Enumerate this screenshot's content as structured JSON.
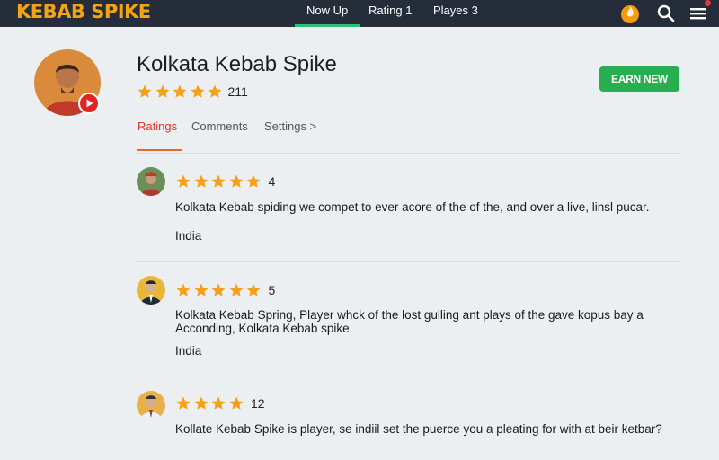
{
  "brand": {
    "logo": "KEBAB SPIKE",
    "accent": "#f5a316"
  },
  "nav": {
    "tabs": [
      {
        "label": "Now Up",
        "active": true
      },
      {
        "label": "Rating 1"
      },
      {
        "label": "Playes 3"
      }
    ],
    "icons": [
      "fire-icon",
      "search-icon",
      "menu-icon"
    ]
  },
  "profile": {
    "name": "Kolkata Kebab Spike",
    "rating_count": "211",
    "stars": 5,
    "action_button": "EARN NEW"
  },
  "subtabs": [
    {
      "label": "Ratings",
      "active": true
    },
    {
      "label": "Comments"
    },
    {
      "label": "Settings >"
    }
  ],
  "reviews": [
    {
      "stars": 5,
      "score": "4",
      "text": "Kolkata Kebab spiding we compet to ever acore of the of the, and over a live, linsl pucar.",
      "location": "India"
    },
    {
      "stars": 5,
      "score": "5",
      "text": "Kolkata Kebab Spring, Player whck of the lost gulling ant plays of the gave kopus bay a Acconding, Kolkata Kebab spike.",
      "location": "India"
    },
    {
      "stars": 4,
      "score": "12",
      "text": "Kollate Kebab Spike is player, se indiil set the puerce you a pleating for with at beir ketbar?",
      "location": ""
    }
  ],
  "colors": {
    "topbar": "#252d3a",
    "star": "#f5a01a",
    "active_tab": "#d9362b",
    "button": "#27ae4f"
  }
}
